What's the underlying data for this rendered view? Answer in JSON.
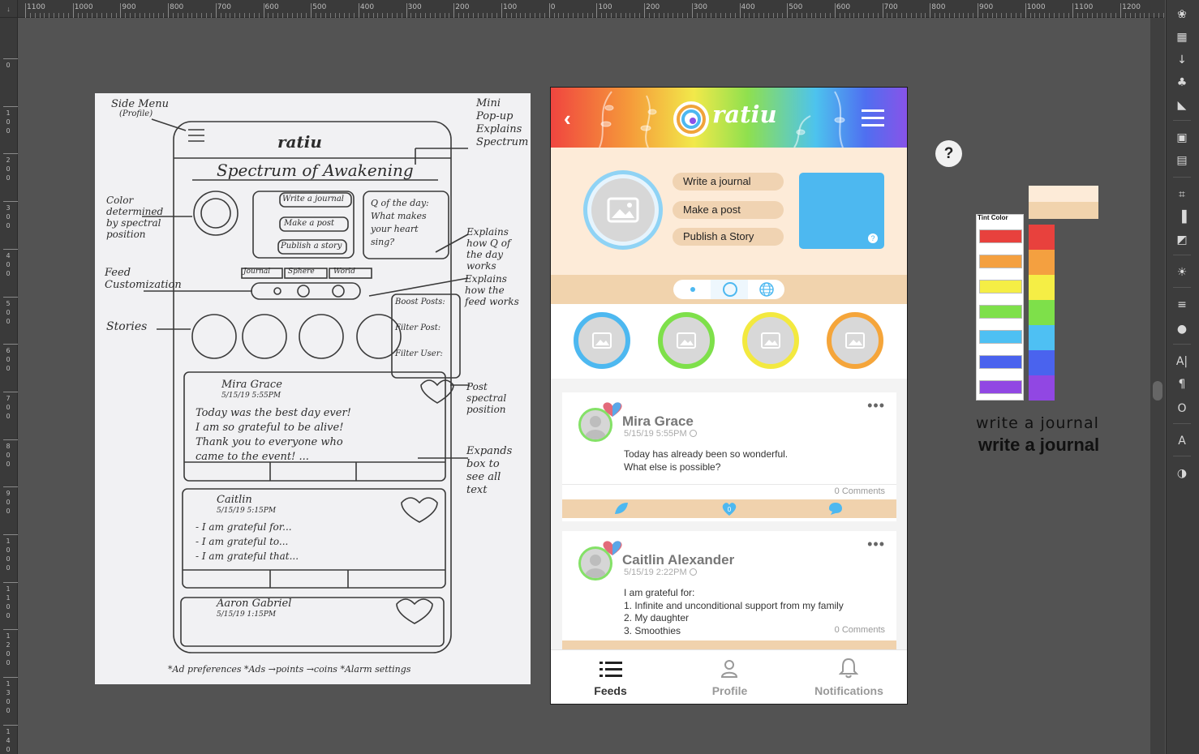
{
  "ruler": {
    "top_labels": [
      "1100",
      "1000",
      "900",
      "800",
      "700",
      "600",
      "500",
      "400",
      "300",
      "200",
      "100",
      "0",
      "100",
      "200",
      "300",
      "400",
      "500",
      "600",
      "700",
      "800",
      "900",
      "1000",
      "1100",
      "1200"
    ],
    "left_labels": [
      "0",
      "1\n0\n0",
      "2\n0\n0",
      "3\n0\n0",
      "4\n0\n0",
      "5\n0\n0",
      "6\n0\n0",
      "7\n0\n0",
      "8\n0\n0",
      "9\n0\n0",
      "1\n0\n0\n0",
      "1\n1\n0\n0",
      "1\n2\n0\n0",
      "1\n3\n0\n0",
      "1\n4\n0\n0"
    ]
  },
  "sketch": {
    "side_menu": "Side Menu",
    "profile_note": "(Profile)",
    "logo": "ratiu",
    "title": "Spectrum of Awakening",
    "mini_popup": "Mini\nPop-up\nExplains\nSpectrum",
    "color_note": "Color\ndetermined\nby spectral\nposition",
    "btn_journal": "Write a journal",
    "btn_post": "Make a post",
    "btn_story": "Publish a story",
    "qod": "Q of the day:\nWhat makes\nyour heart\nsing?",
    "explains_q": "Explains\nhow Q of\nthe day\nworks",
    "feed_custom": "Feed\nCustomization",
    "tabs": [
      "Journal",
      "Sphere",
      "World"
    ],
    "explains_feed": "Explains\nhow the\nfeed works",
    "boost": "Boost Posts:",
    "filter_post": "Filter Post:",
    "filter_user": "Filter User:",
    "stories": "Stories",
    "post1_name": "Mira Grace",
    "post1_date": "5/15/19  5:55PM",
    "post1_body": "Today was the best day ever!\nI am so grateful to be alive!\nThank you to everyone who\ncame to the event! ...",
    "post_spectral": "Post\nspectral\nposition",
    "expands": "Expands\nbox to\nsee all\ntext",
    "post2_name": "Caitlin",
    "post2_date": "5/15/19  5:15PM",
    "post2_body": "- I am grateful for...\n- I am grateful to...\n- I am grateful that...",
    "post3_name": "Aaron Gabriel",
    "post3_date": "5/15/19  1:15PM",
    "footer": "*Ad preferences  *Ads  →points  →coins   *Alarm   settings"
  },
  "app": {
    "logo_text": "ratiu",
    "buttons": [
      "Write a journal",
      "Make a post",
      "Publish a Story"
    ],
    "posts": [
      {
        "name": "Mira Grace",
        "date": "5/15/19 5:55PM",
        "body": [
          "Today has already been so wonderful.",
          "What else is possible?"
        ],
        "comments": "0 Comments",
        "likes": "0"
      },
      {
        "name": "Caitlin Alexander",
        "date": "5/15/19 2:22PM",
        "body": [
          "I am grateful for:",
          "1. Infinite and unconditional support from my family",
          "2. My daughter",
          "3. Smoothies"
        ],
        "comments": "0 Comments"
      }
    ],
    "nav": [
      {
        "label": "Feeds",
        "icon": "list-icon"
      },
      {
        "label": "Profile",
        "icon": "person-icon"
      },
      {
        "label": "Notifications",
        "icon": "bell-icon"
      }
    ],
    "story_ring_colors": [
      "#4db8f0",
      "#7ee04a",
      "#f3e93f",
      "#f5a53a"
    ]
  },
  "help_button": "?",
  "swatches": {
    "label": "Tint Color",
    "tint_colors": [
      "#e8413d",
      "#f4a040",
      "#f5ee45",
      "#7ee04a",
      "#4ec0f3",
      "#4a63ee",
      "#9147e3"
    ],
    "stripe_colors": [
      "#e8413d",
      "#f4a040",
      "#f5ee45",
      "#7ee04a",
      "#4ec0f3",
      "#4a63ee",
      "#9147e3"
    ],
    "cream_colors": [
      "#fdebd8",
      "#f1d3ad"
    ]
  },
  "font_preview": {
    "script": "write a journal",
    "bold": "write a journal"
  },
  "tools": [
    "palette-icon",
    "table-icon",
    "usb-icon",
    "club-icon",
    "gradient-icon",
    "frame-icon",
    "rect-icon",
    "crop-icon",
    "align-icon",
    "layers-icon",
    "brightness-icon",
    "lines-icon",
    "circles-icon",
    "text-icon",
    "paragraph-icon",
    "glyph-o-icon",
    "glyph-a-icon",
    "globe-icon"
  ],
  "tool_glyphs": [
    "❀",
    "▦",
    "↓",
    "♣",
    "◣",
    "▣",
    "▤",
    "⌗",
    "▐",
    "◩",
    "☀",
    "≡",
    "●",
    "A|",
    "¶",
    "O",
    "A",
    "◑"
  ]
}
